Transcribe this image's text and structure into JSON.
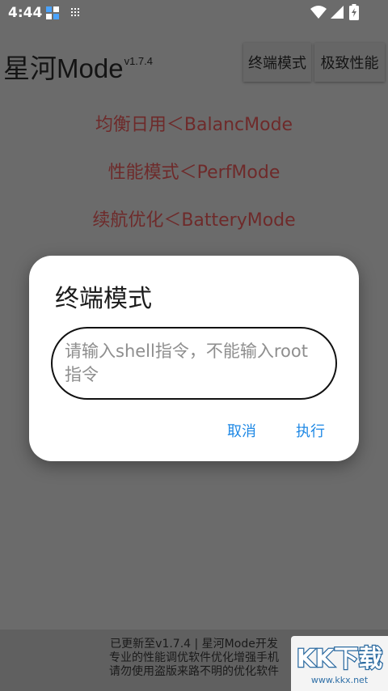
{
  "status_bar": {
    "time": "4:44",
    "icons": [
      "app-icon",
      "grid-icon",
      "wifi-icon",
      "signal-icon",
      "battery-charging-icon"
    ]
  },
  "app": {
    "title": "星河Mode",
    "version": "v1.7.4",
    "terminal_button": "终端模式",
    "extreme_button": "极致性能"
  },
  "modes": [
    {
      "label": "均衡日用＜BalancMode"
    },
    {
      "label": "性能模式＜PerfMode"
    },
    {
      "label": "续航优化＜BatteryMode"
    }
  ],
  "dialog": {
    "title": "终端模式",
    "input_placeholder": "请输入shell指令，不能输入root指令",
    "cancel_label": "取消",
    "execute_label": "执行"
  },
  "footer": {
    "line1": "已更新至v1.7.4 | 星河Mode开发",
    "line2": "专业的性能调优软件优化增强手机",
    "line3": "请勿使用盗版来路不明的优化软件"
  },
  "watermark": {
    "logo_text": "KK下载",
    "url": "www.kkx.net"
  },
  "colors": {
    "dim_background": "#6b6b6b",
    "mode_text": "#6e2a2a",
    "dialog_button": "#1e88e5"
  }
}
